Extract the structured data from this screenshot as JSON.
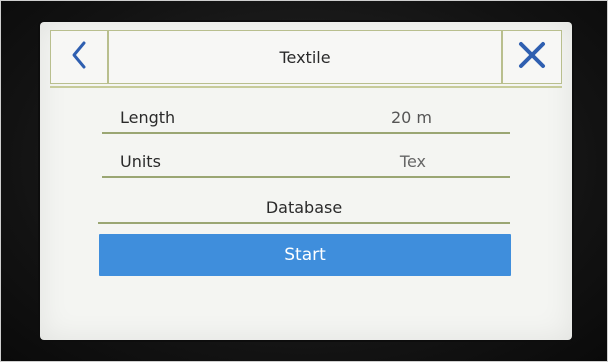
{
  "header": {
    "title": "Textile",
    "back_icon": "chevron-left-icon",
    "close_icon": "close-icon"
  },
  "form": {
    "length": {
      "label": "Length",
      "value": "20 m"
    },
    "units": {
      "label": "Units",
      "value": "Tex"
    },
    "database": {
      "label": "Database"
    }
  },
  "actions": {
    "start_label": "Start"
  },
  "colors": {
    "accent": "#3f8edc",
    "divider": "#9aa673",
    "icon": "#2f5fb0"
  }
}
